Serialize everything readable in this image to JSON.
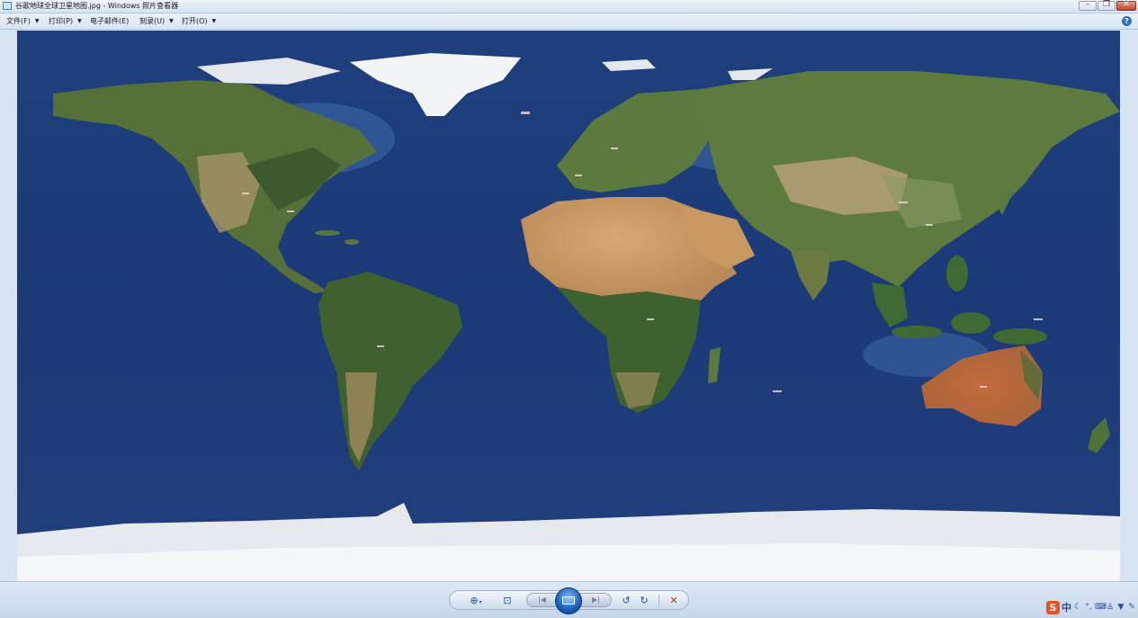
{
  "window": {
    "title": "谷歌地球全球卫星地图.jpg - Windows 照片查看器",
    "icon": "photo-viewer-icon"
  },
  "window_controls": {
    "minimize": "minimize-icon",
    "maximize": "restore-icon",
    "close": "close-icon"
  },
  "menu": {
    "items": [
      {
        "label": "文件(F)"
      },
      {
        "label": "打印(P)"
      },
      {
        "label": "电子邮件(E)"
      },
      {
        "label": "刻录(U)"
      },
      {
        "label": "打开(O)"
      }
    ],
    "help_icon": "help-icon"
  },
  "image": {
    "description_icon": "world-satellite-map",
    "colors": {
      "ocean": "#1c3a78",
      "land_green": "#4c6a34",
      "desert": "#c99a63",
      "ice": "#e9ecf0"
    }
  },
  "toolbar": {
    "zoom_icon": "magnifier-icon",
    "fit_icon": "actual-size-icon",
    "prev_icon": "previous-icon",
    "slideshow_icon": "slideshow-icon",
    "next_icon": "next-icon",
    "rotate_ccw_icon": "rotate-counterclockwise-icon",
    "rotate_cw_icon": "rotate-clockwise-icon",
    "delete_icon": "delete-icon"
  },
  "ime": {
    "logo": "S",
    "mode": "中"
  }
}
